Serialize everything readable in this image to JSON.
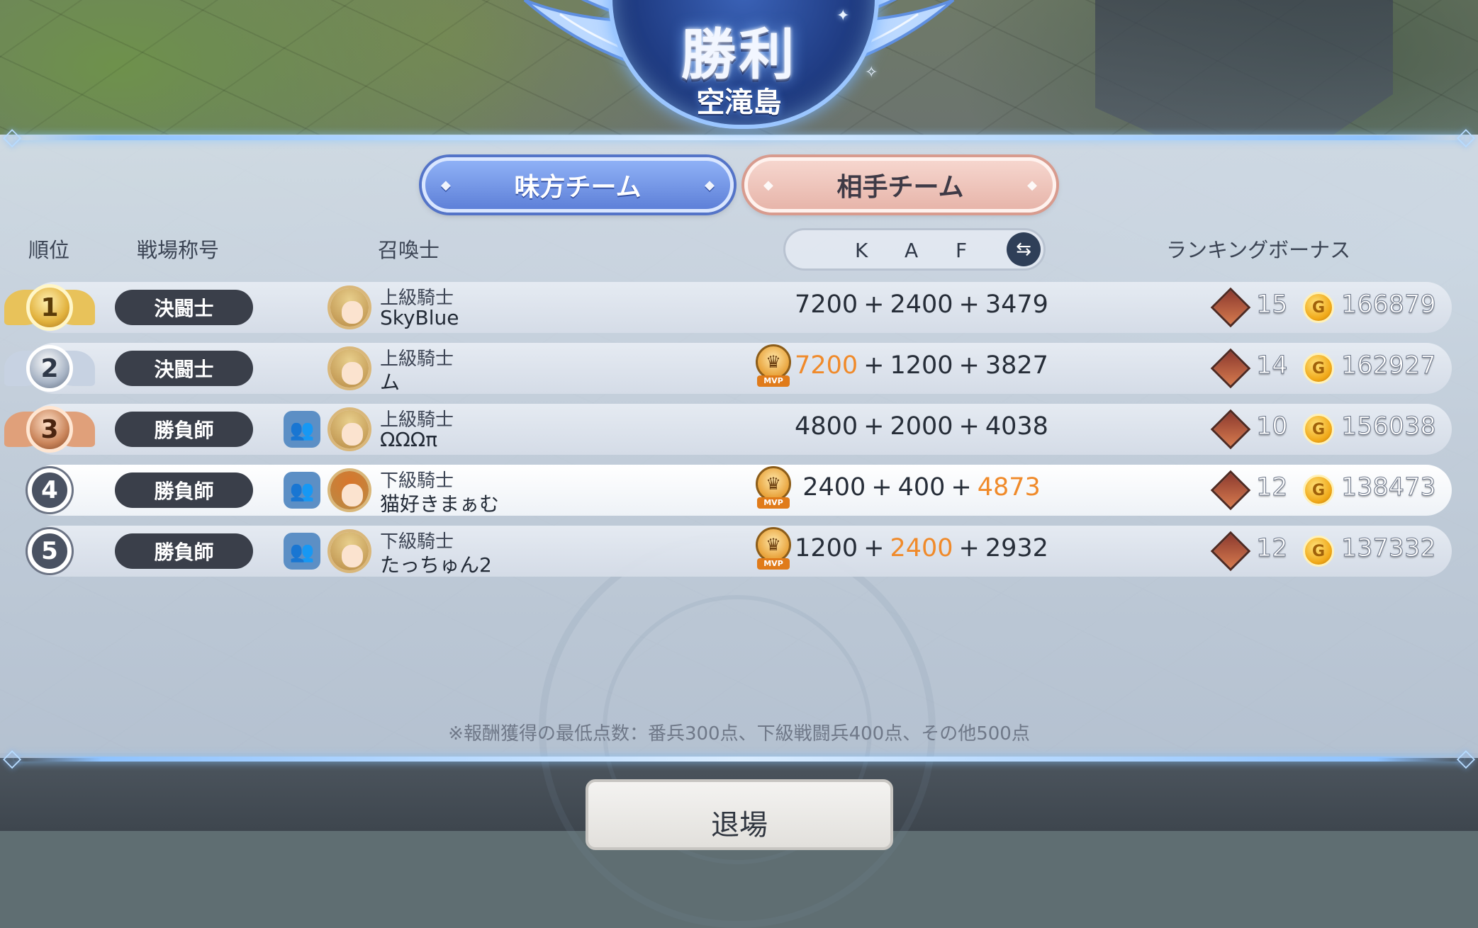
{
  "header": {
    "title": "勝利",
    "subtitle": "空滝島"
  },
  "tabs": {
    "ally": "味方チーム",
    "enemy": "相手チーム"
  },
  "columns": {
    "rank": "順位",
    "title": "戦場称号",
    "summoner": "召喚士",
    "k": "K",
    "a": "A",
    "f": "F",
    "bonus": "ランキングボーナス"
  },
  "players": [
    {
      "rank": "1",
      "badge": "決闘士",
      "party": false,
      "grade": "上級騎士",
      "name": "SkyBlue",
      "mvp": false,
      "k": "7200",
      "a": "2400",
      "f": "3479",
      "hi": "",
      "crests": "15",
      "gold": "166879"
    },
    {
      "rank": "2",
      "badge": "決闘士",
      "party": false,
      "grade": "上級騎士",
      "name": "ム",
      "mvp": true,
      "k": "7200",
      "a": "1200",
      "f": "3827",
      "hi": "k",
      "crests": "14",
      "gold": "162927"
    },
    {
      "rank": "3",
      "badge": "勝負師",
      "party": true,
      "grade": "上級騎士",
      "name": "ΩΩΩπ",
      "mvp": false,
      "k": "4800",
      "a": "2000",
      "f": "4038",
      "hi": "",
      "crests": "10",
      "gold": "156038"
    },
    {
      "rank": "4",
      "badge": "勝負師",
      "party": true,
      "grade": "下級騎士",
      "name": "猫好きまぁむ",
      "mvp": true,
      "k": "2400",
      "a": "400",
      "f": "4873",
      "hi": "f",
      "crests": "12",
      "gold": "138473"
    },
    {
      "rank": "5",
      "badge": "勝負師",
      "party": true,
      "grade": "下級騎士",
      "name": "たっちゅん2",
      "mvp": true,
      "k": "1200",
      "a": "2400",
      "f": "2932",
      "hi": "a",
      "crests": "12",
      "gold": "137332"
    }
  ],
  "mvp_label": "MVP",
  "plus": "+",
  "note": "※報酬獲得の最低点数：番兵300点、下級戦闘兵400点、その他500点",
  "exit_label": "退場",
  "icons": {
    "swap": "swap-arrows-icon",
    "party": "party-icon",
    "crest": "crest-icon",
    "coin": "gold-coin-icon"
  },
  "colors": {
    "ally_tab": "#6f92e6",
    "enemy_tab": "#ecc1b7",
    "highlight": "#f08a2a",
    "badge_bg": "#3a3f4a",
    "rank_gold": "#e2b23e",
    "rank_silver": "#a7b3c4",
    "rank_bronze": "#c9845a"
  }
}
